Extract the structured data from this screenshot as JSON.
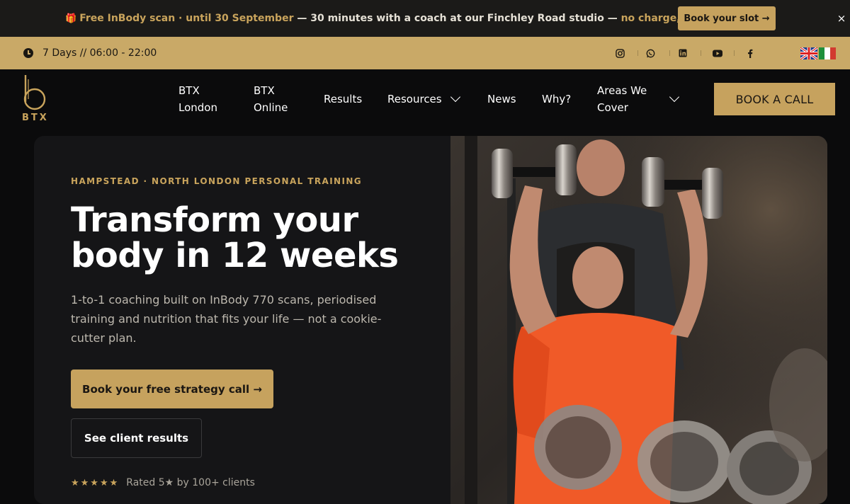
{
  "promo": {
    "gift_icon": "gift-icon",
    "lead": "Free InBody scan · until 30 September",
    "middle": " — 30 minutes with a coach at our Finchley Road studio — ",
    "tail": "no charge, no obligation",
    "button": "Book your slot →",
    "close": "×"
  },
  "infobar": {
    "hours": "7 Days // 06:00 - 22:00",
    "socials": [
      "instagram-icon",
      "whatsapp-icon",
      "linkedin-icon",
      "youtube-icon",
      "facebook-icon"
    ],
    "languages": [
      "en",
      "it"
    ]
  },
  "nav": {
    "logo_text": "BTX",
    "items": [
      {
        "line1": "BTX",
        "line2": "London"
      },
      {
        "line1": "BTX",
        "line2": "Online"
      },
      {
        "line1": "Results"
      },
      {
        "line1": "Resources"
      },
      {
        "line1": "News"
      },
      {
        "line1": "Why?"
      },
      {
        "line1": "Areas We",
        "line2": "Cover"
      }
    ],
    "cta": "BOOK A CALL"
  },
  "hero": {
    "eyebrow": "HAMPSTEAD · NORTH LONDON PERSONAL TRAINING",
    "headline": "Transform your body in 12 weeks",
    "subtext": "1-to-1 coaching built on InBody 770 scans, periodised training and nutrition that fits your life — not a cookie-cutter plan.",
    "primary_cta": "Book your free strategy call →",
    "secondary_cta": "See client results",
    "stars": "★★★★★",
    "rating": "Rated 5★ by 100+ clients"
  },
  "colors": {
    "gold": "#c6a25e",
    "dark": "#0b0b0c",
    "card": "#151517",
    "promo_bg": "#1b1a18"
  }
}
